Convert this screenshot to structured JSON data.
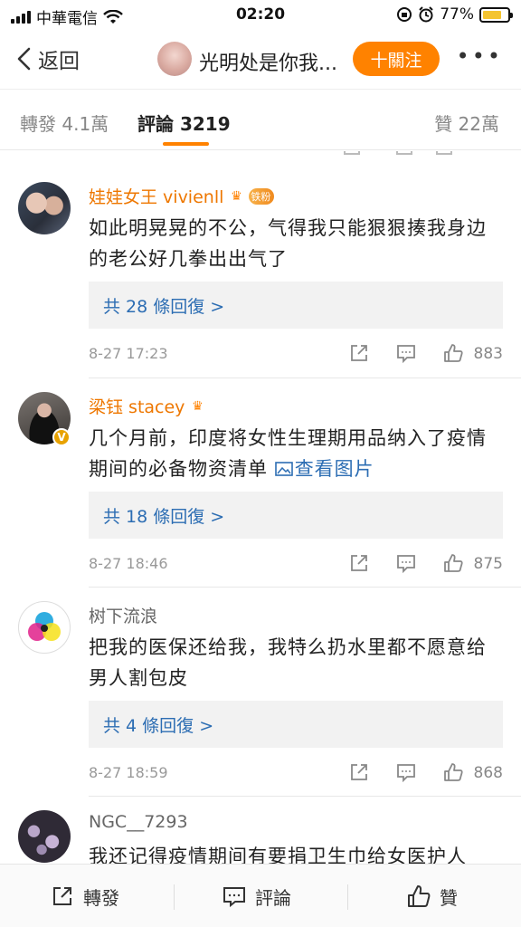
{
  "status_bar": {
    "carrier": "中華電信",
    "time": "02:20",
    "battery": "77%",
    "battery_level": 0.77
  },
  "nav": {
    "back_label": "返回",
    "title": "光明处是你我...",
    "follow_label": "十關注"
  },
  "tabs": [
    {
      "label": "轉發 4.1萬"
    },
    {
      "label": "評論 3219"
    },
    {
      "label": "贊 22萬"
    }
  ],
  "comments": [
    {
      "username": "娃娃女王 vivienll",
      "badge": "铁粉",
      "text": "如此明晃晃的不公，气得我只能狠狠揍我身边的老公好几拳出出气了",
      "link": "",
      "replies": "共 28 條回復 >",
      "time": "8-27 17:23",
      "likes": "883"
    },
    {
      "username": "梁钰 stacey",
      "badge": "",
      "text": "几个月前，印度将女性生理期用品纳入了疫情期间的必备物资清单 ",
      "link": "查看图片",
      "replies": "共 18 條回復 >",
      "time": "8-27 18:46",
      "likes": "875"
    },
    {
      "username": "树下流浪",
      "badge": "",
      "text": "把我的医保还给我，我特么扔水里都不愿意给男人割包皮",
      "link": "",
      "replies": "共 4 條回復 >",
      "time": "8-27 18:59",
      "likes": "868"
    },
    {
      "username": "NGC__7293",
      "badge": "",
      "text": "我还记得疫情期间有要捐卫生巾给女医护人",
      "link": "",
      "replies": "",
      "time": "",
      "likes": ""
    }
  ],
  "toolbar": {
    "repost_label": "轉發",
    "comment_label": "評論",
    "like_label": "贊"
  },
  "colors": {
    "accent": "#ff8200",
    "link": "#2c6db3",
    "vip_name": "#ee7700"
  }
}
